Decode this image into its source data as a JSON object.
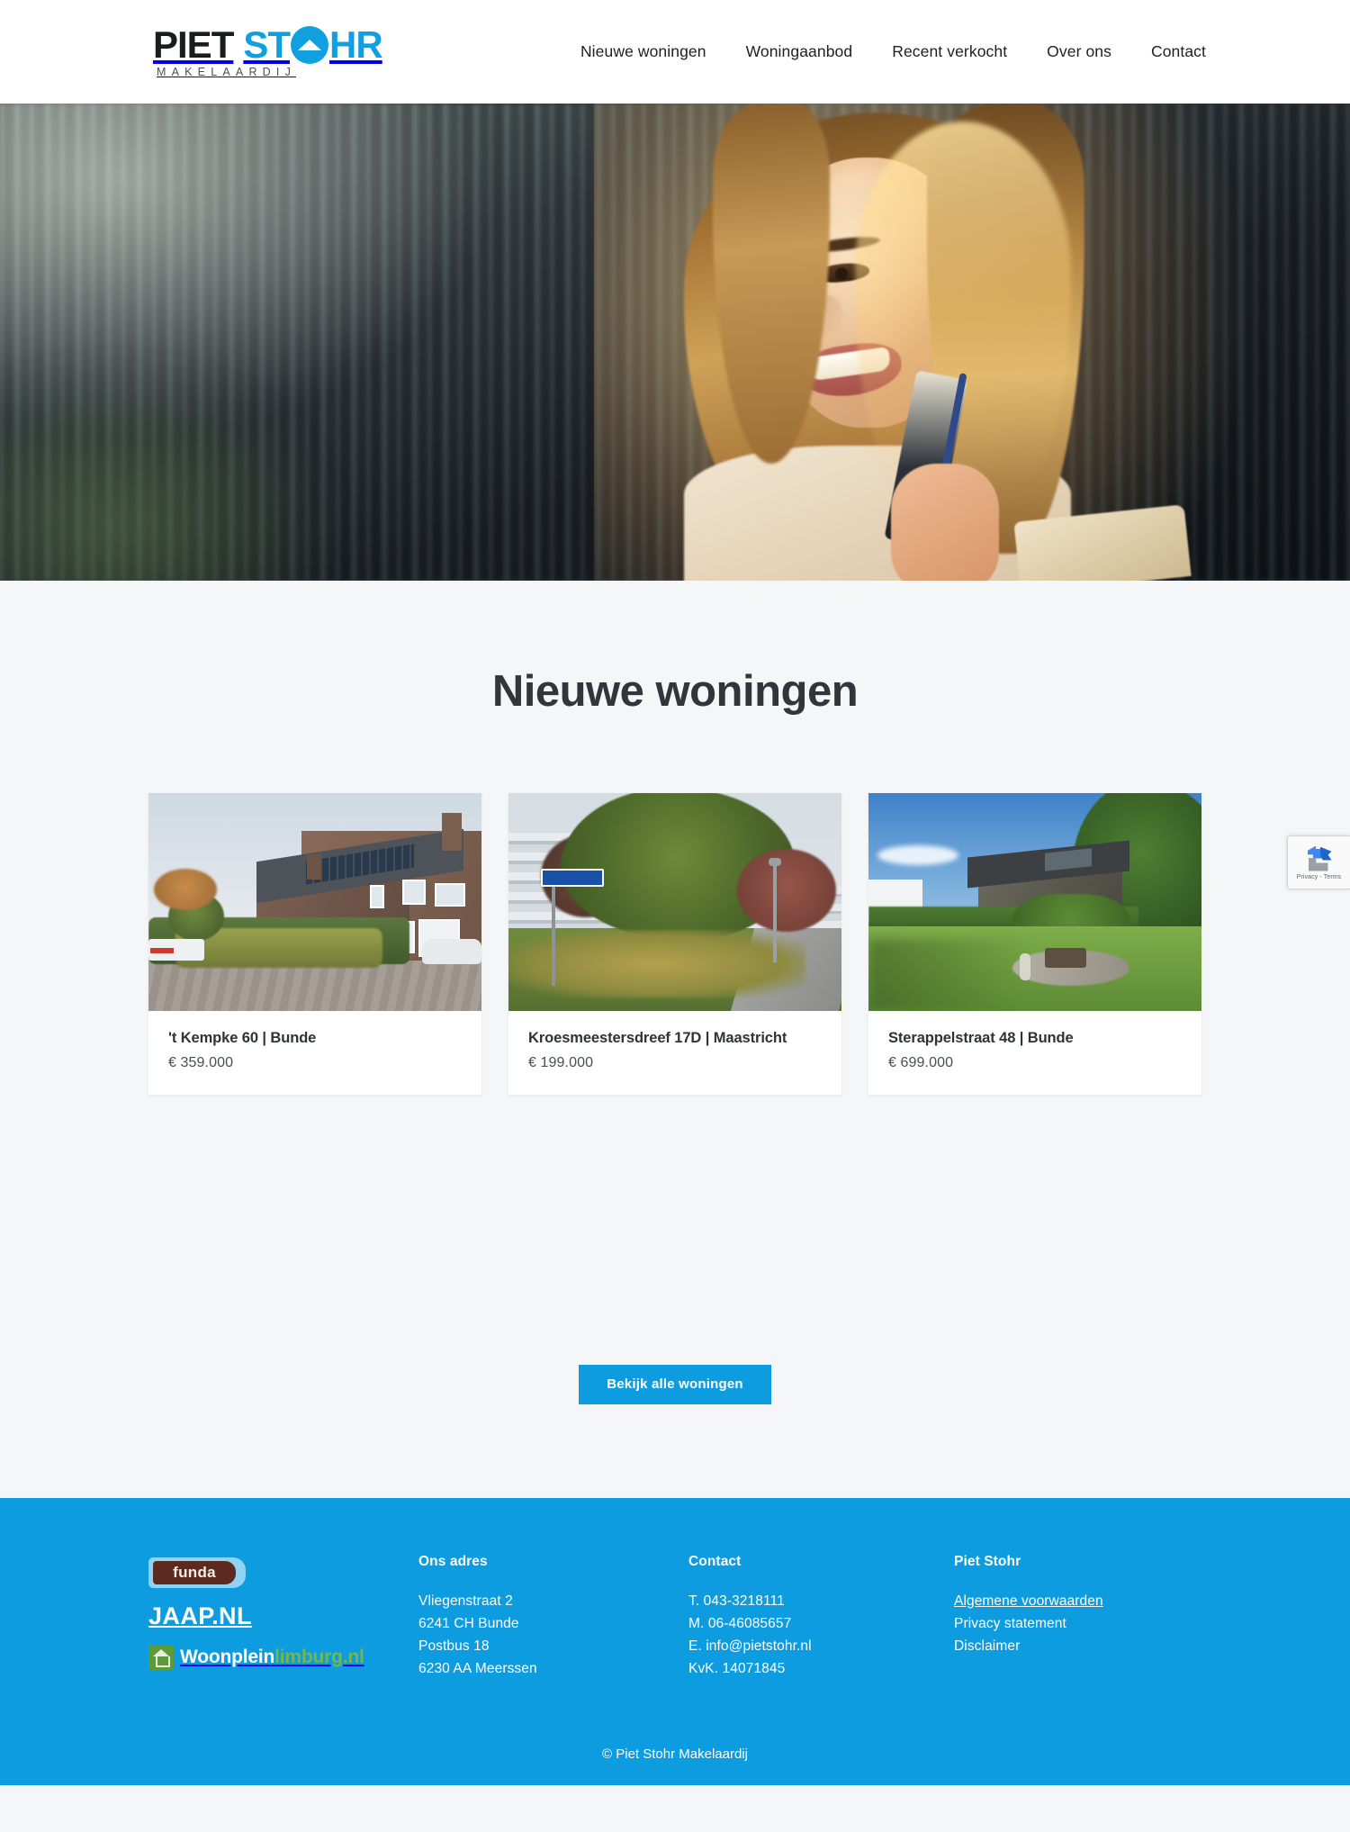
{
  "brand": {
    "logo_primary": "PIET",
    "logo_secondary_left": "ST",
    "logo_secondary_right": "HR",
    "logo_tagline": "MAKELAARDIJ",
    "accent_blue": "#0e9ce0",
    "logo_dark": "#1b1c1e"
  },
  "nav": {
    "items": [
      {
        "label": "Nieuwe woningen"
      },
      {
        "label": "Woningaanbod"
      },
      {
        "label": "Recent verkocht"
      },
      {
        "label": "Over ons"
      },
      {
        "label": "Contact"
      }
    ]
  },
  "hero": {
    "alt": "Lachende vrouw met telefoon in zonlicht voor kantoorgebouw"
  },
  "main": {
    "section_title": "Nieuwe woningen",
    "cards": [
      {
        "title": "'t Kempke 60 | Bunde",
        "price": "€ 359.000",
        "photo_alt": "Bakstenen woning met zonnepanelen en voortuin"
      },
      {
        "title": "Kroesmeestersdreef 17D | Maastricht",
        "price": "€ 199.000",
        "photo_alt": "Appartementencomplex met grote boom en herfstbladeren"
      },
      {
        "title": "Sterappelstraat 48 | Bunde",
        "price": "€ 699.000",
        "photo_alt": "Villa met grote zonnige tuin en hagen"
      }
    ],
    "cta_label": "Bekijk alle woningen"
  },
  "footer": {
    "partners": {
      "funda": "funda",
      "jaap": "JAAP.NL",
      "woonplein_a": "Woonplein",
      "woonplein_b": "limburg.nl"
    },
    "address": {
      "heading": "Ons adres",
      "lines": [
        "Vliegenstraat 2",
        "6241 CH Bunde",
        "Postbus 18",
        "6230 AA Meerssen"
      ]
    },
    "contact": {
      "heading": "Contact",
      "lines": [
        "T. 043-3218111",
        "M. 06-46085657",
        "E. info@pietstohr.nl",
        "KvK. 14071845"
      ]
    },
    "company": {
      "heading": "Piet Stohr",
      "links": [
        {
          "label": "Algemene voorwaarden",
          "underlined": true
        },
        {
          "label": "Privacy statement",
          "underlined": false
        },
        {
          "label": "Disclaimer",
          "underlined": false
        }
      ]
    },
    "copyright": "© Piet Stohr Makelaardij"
  },
  "recaptcha": {
    "label": "Privacy - Terms"
  }
}
